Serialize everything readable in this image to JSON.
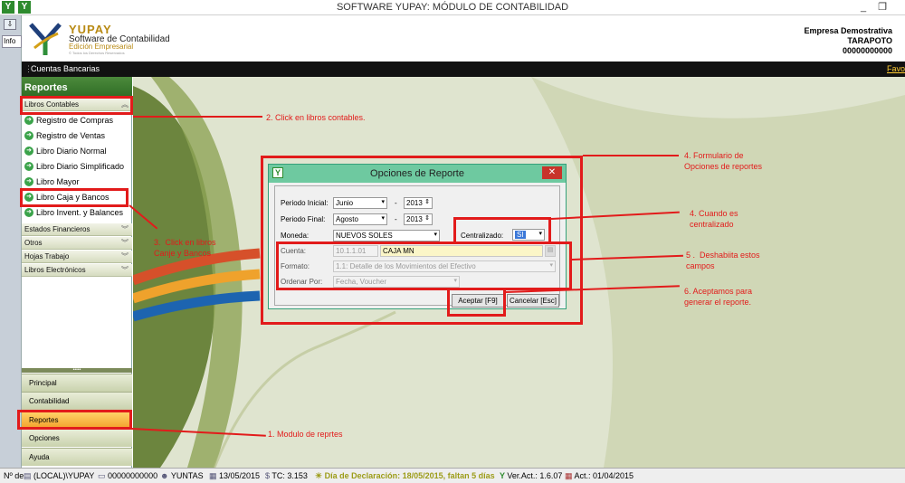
{
  "window": {
    "title": "SOFTWARE YUPAY: MÓDULO DE CONTABILIDAD",
    "minimize": "_",
    "restore": "❐"
  },
  "leftstrip": {
    "tab": "Info",
    "sidebar_label": "Nº de"
  },
  "brand": {
    "name": "YUPAY",
    "subtitle": "Software de Contabilidad",
    "edition": "Edición Empresarial",
    "tagline": "© Todos los Derechos Reservados"
  },
  "company": {
    "name": "Empresa Demostrativa",
    "city": "TARAPOTO",
    "ruc": "00000000000"
  },
  "menubar": {
    "item": "Cuentas Bancarias",
    "favorites": "Favo"
  },
  "sidebar": {
    "title": "Reportes",
    "groups": {
      "libros": "Libros Contables",
      "estados": "Estados Financieros",
      "otros": "Otros",
      "hojas": "Hojas Trabajo",
      "electronicos": "Libros Electrónicos"
    },
    "items": [
      "Registro de Compras",
      "Registro de Ventas",
      "Libro Diario Normal",
      "Libro Diario Simplificado",
      "Libro Mayor",
      "Libro Caja y Bancos",
      "Libro Invent. y Balances"
    ],
    "nav": [
      "Principal",
      "Contabilidad",
      "Reportes",
      "Opciones",
      "Ayuda"
    ]
  },
  "dialog": {
    "title": "Opciones de Reporte",
    "close": "✕",
    "labels": {
      "periodo_inicial": "Periodo Inicial:",
      "periodo_final": "Periodo Final:",
      "moneda": "Moneda:",
      "centralizado": "Centralizado:",
      "cuenta": "Cuenta:",
      "formato": "Formato:",
      "ordenar_por": "Ordenar Por:"
    },
    "values": {
      "mes_inicial": "Junio",
      "anio_inicial": "2013",
      "mes_final": "Agosto",
      "anio_final": "2013",
      "moneda": "NUEVOS SOLES",
      "centralizado": "SI",
      "cuenta_codigo": "10.1.1.01",
      "cuenta_nombre": "CAJA MN",
      "formato": "1.1: Detalle de los Movimientos del Efectivo",
      "ordenar_por": "Fecha, Voucher"
    },
    "dash": "-",
    "buttons": {
      "aceptar": "Aceptar [F9]",
      "cancelar": "Cancelar [Esc]"
    }
  },
  "annotations": {
    "a1": "1. Modulo de reprtes",
    "a2": "2. Click en libros contables.",
    "a3": "3.  Click en libros\nCanje y Bancos",
    "a4a": "4. Formulario de\nOpciones de reportes",
    "a4b": "4. Cuando es\ncentralizado",
    "a5": "5 .  Deshabiita estos\ncampos",
    "a6": "6. Aceptamos para\ngenerar el reporte."
  },
  "statusbar": {
    "server": "(LOCAL)\\YUPAY",
    "ruc": "00000000000",
    "user": "YUNTAS",
    "date": "13/05/2015",
    "tc": "TC: 3.153",
    "declaracion": "Día de Declaración: 18/05/2015, faltan 5 días",
    "version": "Ver.Act.: 1.6.07",
    "actualizacion": "Act.: 01/04/2015"
  },
  "colors": {
    "accent_green": "#2f6d25",
    "annotation_red": "#e21b1b",
    "selected_nav": "#f3a02a"
  }
}
